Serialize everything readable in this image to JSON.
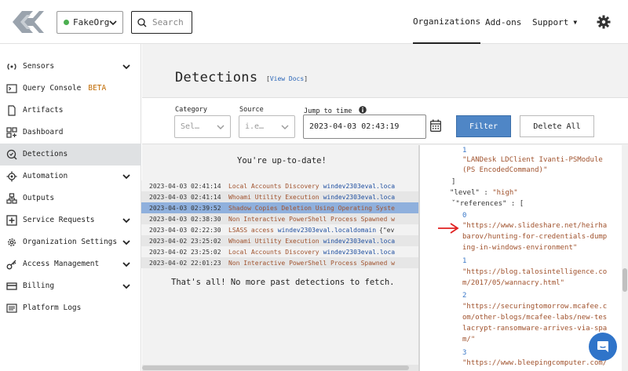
{
  "header": {
    "org_name": "FakeOrg",
    "org_status_color": "#4caf50",
    "search_placeholder": "Search",
    "nav": {
      "organizations": "Organizations",
      "addons": "Add-ons",
      "support": "Support"
    }
  },
  "sidebar": {
    "items": [
      {
        "label": "Sensors",
        "icon": "sensors-icon",
        "expandable": true
      },
      {
        "label": "Query Console",
        "icon": "terminal-icon",
        "badge": "BETA"
      },
      {
        "label": "Artifacts",
        "icon": "file-icon"
      },
      {
        "label": "Dashboard",
        "icon": "dashboard-icon"
      },
      {
        "label": "Detections",
        "icon": "detections-icon",
        "active": true
      },
      {
        "label": "Automation",
        "icon": "gear-icon",
        "expandable": true
      },
      {
        "label": "Outputs",
        "icon": "outputs-icon"
      },
      {
        "label": "Service Requests",
        "icon": "plus-icon",
        "expandable": true
      },
      {
        "label": "Organization Settings",
        "icon": "cog-icon",
        "expandable": true
      },
      {
        "label": "Access Management",
        "icon": "key-icon",
        "expandable": true
      },
      {
        "label": "Billing",
        "icon": "billing-icon",
        "expandable": true
      },
      {
        "label": "Platform Logs",
        "icon": "logs-icon"
      }
    ]
  },
  "page": {
    "title": "Detections",
    "view_docs": "View Docs"
  },
  "filters": {
    "category_label": "Category",
    "category_placeholder": "Sel…",
    "source_label": "Source",
    "source_placeholder": "i.e…",
    "jump_label": "Jump to time",
    "jump_value": "2023-04-03 02:43:19",
    "filter_button": "Filter",
    "delete_button": "Delete All"
  },
  "list": {
    "up_to_date": "You're up-to-date!",
    "no_more": "That's all! No more past detections to fetch.",
    "rows": [
      {
        "ts": "2023-04-03 02:41:14",
        "cat": "Local Accounts Discovery",
        "host": "windev2303eval.loca",
        "ext": ""
      },
      {
        "ts": "2023-04-03 02:41:14",
        "cat": "Whoami Utility Execution",
        "host": "windev2303eval.loca",
        "ext": ""
      },
      {
        "ts": "2023-04-03 02:39:52",
        "cat": "Shadow Copies Deletion Using Operating Syste",
        "host": "",
        "ext": "",
        "selected": true
      },
      {
        "ts": "2023-04-03 02:38:30",
        "cat": "Non Interactive PowerShell Process Spawned w",
        "host": "",
        "ext": ""
      },
      {
        "ts": "2023-04-03 02:22:30",
        "cat": "LSASS access",
        "host": "windev2303eval.localdomain",
        "ext": "{\"ev"
      },
      {
        "ts": "2023-04-02 23:25:02",
        "cat": "Whoami Utility Execution",
        "host": "windev2303eval.loca",
        "ext": ""
      },
      {
        "ts": "2023-04-02 23:25:02",
        "cat": "Local Accounts Discovery",
        "host": "windev2303eval.loca",
        "ext": ""
      },
      {
        "ts": "2023-04-02 22:01:23",
        "cat": "Non Interactive PowerShell Process Spawned w",
        "host": "",
        "ext": ""
      }
    ]
  },
  "json_view": {
    "lines": [
      {
        "idx": "1",
        "text": ""
      },
      {
        "str": "\"LANDesk LDClient Ivanti-PSModule"
      },
      {
        "str": "(PS EncodedCommand)\""
      },
      {
        "punct": "]"
      },
      {
        "key": "\"level\"",
        "val": "\"high\""
      },
      {
        "key": "\"references\"",
        "open": "["
      },
      {
        "idx": "0",
        "text": ""
      },
      {
        "str": "\"https://www.slideshare.net/heirha"
      },
      {
        "str": "barov/hunting-for-credentials-dump"
      },
      {
        "str": "ing-in-windows-environment\""
      },
      {
        "idx": "1",
        "text": ""
      },
      {
        "str": "\"https://blog.talosintelligence.co"
      },
      {
        "str": "m/2017/05/wannacry.html\""
      },
      {
        "idx": "2",
        "text": ""
      },
      {
        "str": "\"https://securingtomorrow.mcafee.c"
      },
      {
        "str": "om/other-blogs/mcafee-labs/new-tes"
      },
      {
        "str": "lacrypt-ransomware-arrives-via-spa"
      },
      {
        "str": "m/\""
      },
      {
        "idx": "3",
        "text": ""
      },
      {
        "str": "\"https://www.bleepingcomputer.com/"
      }
    ]
  },
  "colors": {
    "accent": "#4f86c6",
    "selected_row": "#8fb0dd",
    "annotation_arrow": "#e02020",
    "chat": "#2f74c9"
  }
}
